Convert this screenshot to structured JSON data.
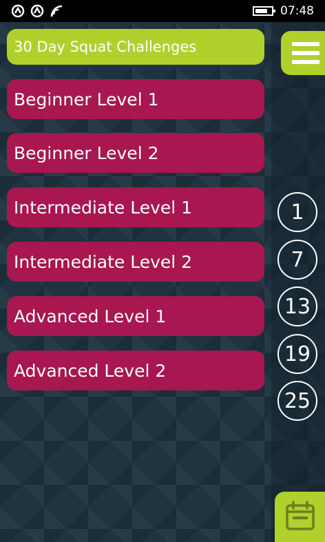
{
  "status_bar": {
    "time": "07:48",
    "icons": [
      "notification-icon",
      "notification-icon",
      "wifi-icon",
      "battery-icon"
    ],
    "battery_level": 0.75
  },
  "title": "30 Day Squat Challenges",
  "levels": [
    "Beginner Level 1",
    "Beginner Level 2",
    "Intermediate Level 1",
    "Intermediate Level 2",
    "Advanced Level 1",
    "Advanced Level 2"
  ],
  "days": [
    "1",
    "7",
    "13",
    "19",
    "25"
  ],
  "colors": {
    "accent_green": "#b0d02c",
    "level_magenta": "#a8174f",
    "background": "#1f3340"
  },
  "icons": {
    "menu": "hamburger-icon",
    "calendar": "calendar-icon"
  }
}
